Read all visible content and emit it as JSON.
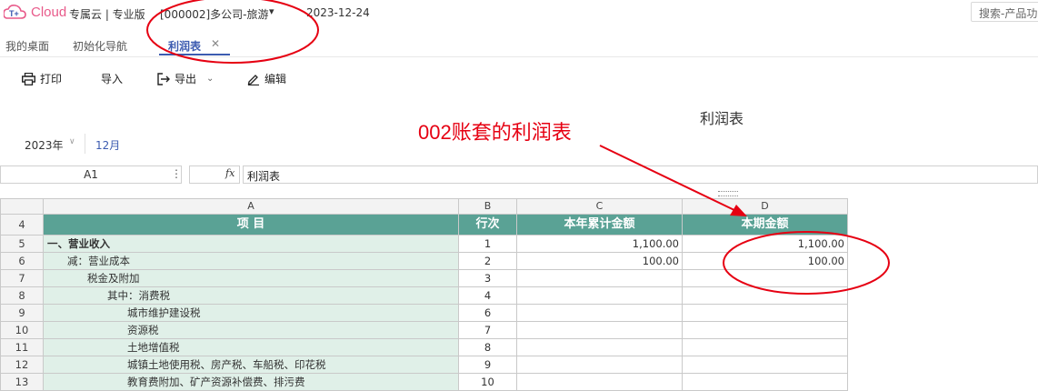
{
  "app": {
    "logo_text": "Cloud",
    "edition": "专属云 | 专业版",
    "company": "[000002]多公司-旅游",
    "date": "2023-12-24",
    "search_placeholder": "搜索-产品功"
  },
  "tabs": [
    {
      "label": "我的桌面"
    },
    {
      "label": "初始化导航"
    },
    {
      "label": "利润表",
      "active": true
    }
  ],
  "toolbar": {
    "print": "打印",
    "import": "导入",
    "export": "导出",
    "edit": "编辑"
  },
  "report": {
    "title": "利润表",
    "annotation": "002账套的利润表",
    "year": "2023年",
    "month": "12月"
  },
  "formula_bar": {
    "cell_ref": "A1",
    "fx": "fx",
    "value": "利润表"
  },
  "grid": {
    "columns": [
      "A",
      "B",
      "C",
      "D"
    ],
    "header_row": {
      "row_num": "4",
      "cells": [
        "项 目",
        "行次",
        "本年累计金额",
        "本期金额"
      ]
    },
    "rows": [
      {
        "row_num": "5",
        "item": "一、营业收入",
        "indent": 0,
        "bold": true,
        "line": "1",
        "ytd": "1,100.00",
        "period": "1,100.00"
      },
      {
        "row_num": "6",
        "item": "减：营业成本",
        "indent": 1,
        "bold": false,
        "line": "2",
        "ytd": "100.00",
        "period": "100.00"
      },
      {
        "row_num": "7",
        "item": "税金及附加",
        "indent": 2,
        "bold": false,
        "line": "3",
        "ytd": "",
        "period": ""
      },
      {
        "row_num": "8",
        "item": "其中：消费税",
        "indent": 3,
        "bold": false,
        "line": "4",
        "ytd": "",
        "period": ""
      },
      {
        "row_num": "9",
        "item": "城市维护建设税",
        "indent": 4,
        "bold": false,
        "line": "6",
        "ytd": "",
        "period": ""
      },
      {
        "row_num": "10",
        "item": "资源税",
        "indent": 4,
        "bold": false,
        "line": "7",
        "ytd": "",
        "period": ""
      },
      {
        "row_num": "11",
        "item": "土地增值税",
        "indent": 4,
        "bold": false,
        "line": "8",
        "ytd": "",
        "period": ""
      },
      {
        "row_num": "12",
        "item": "城镇土地使用税、房产税、车船税、印花税",
        "indent": 4,
        "bold": false,
        "line": "9",
        "ytd": "",
        "period": ""
      },
      {
        "row_num": "13",
        "item": "教育费附加、矿产资源补偿费、排污费",
        "indent": 4,
        "bold": false,
        "line": "10",
        "ytd": "",
        "period": ""
      }
    ]
  },
  "colors": {
    "accent": "#3c5bb0",
    "header_fill": "#5aa295",
    "item_fill": "#e0f0e8",
    "annotation_red": "#e60012"
  }
}
